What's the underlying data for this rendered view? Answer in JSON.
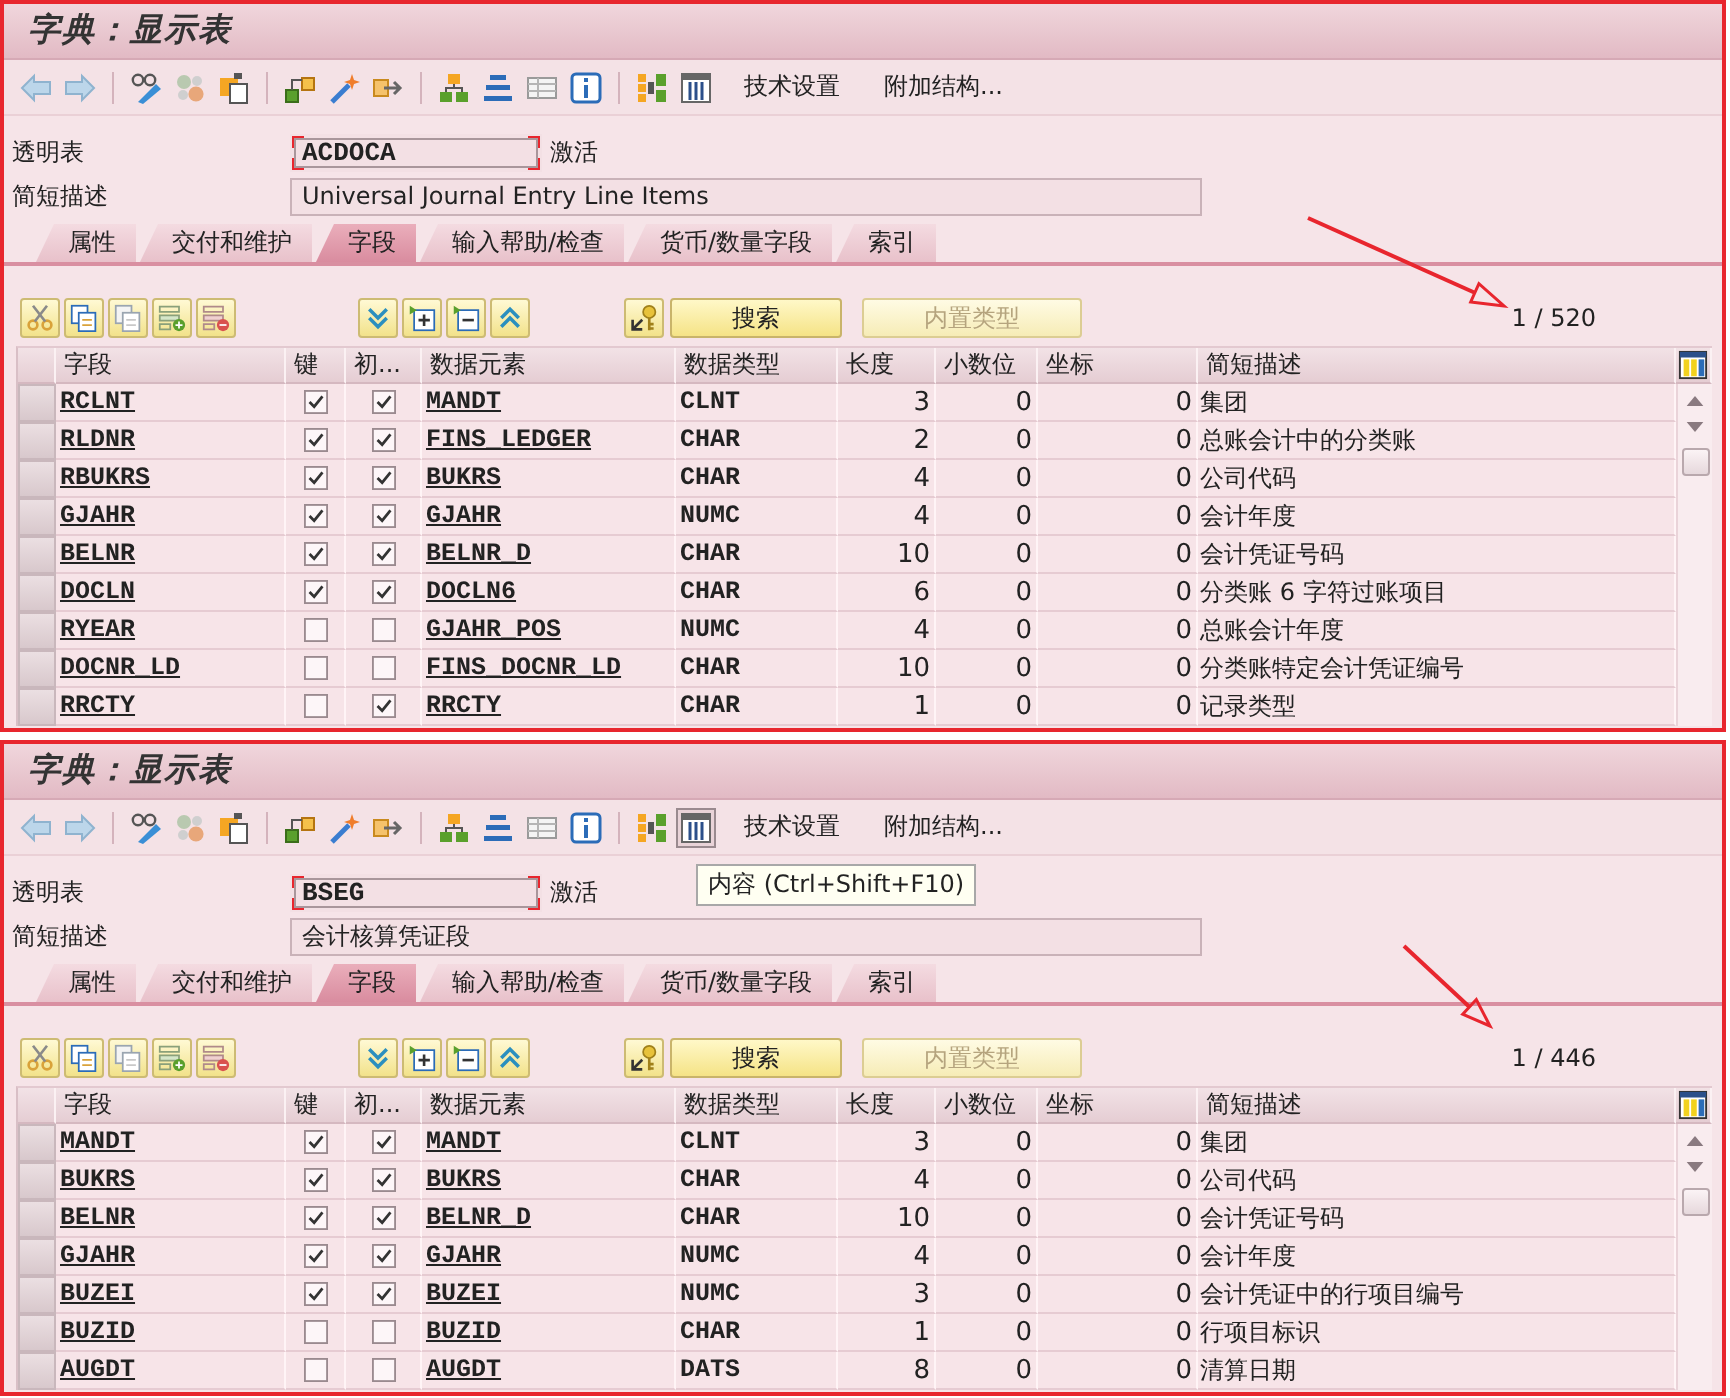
{
  "screens": [
    {
      "title": "字典：显示表",
      "toolbar_buttons": [
        "技术设置",
        "附加结构..."
      ],
      "fields": [
        {
          "label": "透明表",
          "value": "ACDOCA",
          "status": "激活",
          "focused": true
        },
        {
          "label": "简短描述",
          "value": "Universal Journal Entry Line Items",
          "focused": false
        }
      ],
      "tabs": [
        {
          "label": "属性",
          "selected": false
        },
        {
          "label": "交付和维护",
          "selected": false
        },
        {
          "label": "字段",
          "selected": true
        },
        {
          "label": "输入帮助/检查",
          "selected": false
        },
        {
          "label": "货币/数量字段",
          "selected": false
        },
        {
          "label": "索引",
          "selected": false
        }
      ],
      "table_toolbar": [
        {
          "label": "搜索",
          "disabled": false
        },
        {
          "label": "内置类型",
          "disabled": true
        }
      ],
      "count": "1 / 520",
      "table": {
        "columns": [
          "字段",
          "键",
          "初...",
          "数据元素",
          "数据类型",
          "长度",
          "小数位",
          "坐标",
          "简短描述"
        ],
        "rows": [
          {
            "field": "RCLNT",
            "key": true,
            "initial": true,
            "data_element": "MANDT",
            "data_type": "CLNT",
            "length": "3",
            "decimals": "0",
            "coordinate": "0",
            "description": "集团"
          },
          {
            "field": "RLDNR",
            "key": true,
            "initial": true,
            "data_element": "FINS_LEDGER",
            "data_type": "CHAR",
            "length": "2",
            "decimals": "0",
            "coordinate": "0",
            "description": "总账会计中的分类账"
          },
          {
            "field": "RBUKRS",
            "key": true,
            "initial": true,
            "data_element": "BUKRS",
            "data_type": "CHAR",
            "length": "4",
            "decimals": "0",
            "coordinate": "0",
            "description": "公司代码"
          },
          {
            "field": "GJAHR",
            "key": true,
            "initial": true,
            "data_element": "GJAHR",
            "data_type": "NUMC",
            "length": "4",
            "decimals": "0",
            "coordinate": "0",
            "description": "会计年度"
          },
          {
            "field": "BELNR",
            "key": true,
            "initial": true,
            "data_element": "BELNR_D",
            "data_type": "CHAR",
            "length": "10",
            "decimals": "0",
            "coordinate": "0",
            "description": "会计凭证号码"
          },
          {
            "field": "DOCLN",
            "key": true,
            "initial": true,
            "data_element": "DOCLN6",
            "data_type": "CHAR",
            "length": "6",
            "decimals": "0",
            "coordinate": "0",
            "description": "分类账 6 字符过账项目"
          },
          {
            "field": "RYEAR",
            "key": false,
            "initial": false,
            "data_element": "GJAHR_POS",
            "data_type": "NUMC",
            "length": "4",
            "decimals": "0",
            "coordinate": "0",
            "description": "总账会计年度"
          },
          {
            "field": "DOCNR_LD",
            "key": false,
            "initial": false,
            "data_element": "FINS_DOCNR_LD",
            "data_type": "CHAR",
            "length": "10",
            "decimals": "0",
            "coordinate": "0",
            "description": "分类账特定会计凭证编号"
          },
          {
            "field": "RRCTY",
            "key": false,
            "initial": true,
            "data_element": "RRCTY",
            "data_type": "CHAR",
            "length": "1",
            "decimals": "0",
            "coordinate": "0",
            "description": "记录类型"
          }
        ]
      }
    },
    {
      "title": "字典：显示表",
      "toolbar_buttons": [
        "技术设置",
        "附加结构..."
      ],
      "tooltip": "内容 (Ctrl+Shift+F10)",
      "fields": [
        {
          "label": "透明表",
          "value": "BSEG",
          "status": "激活",
          "focused": true
        },
        {
          "label": "简短描述",
          "value": "会计核算凭证段",
          "focused": false
        }
      ],
      "tabs": [
        {
          "label": "属性",
          "selected": false
        },
        {
          "label": "交付和维护",
          "selected": false
        },
        {
          "label": "字段",
          "selected": true
        },
        {
          "label": "输入帮助/检查",
          "selected": false
        },
        {
          "label": "货币/数量字段",
          "selected": false
        },
        {
          "label": "索引",
          "selected": false
        }
      ],
      "table_toolbar": [
        {
          "label": "搜索",
          "disabled": false
        },
        {
          "label": "内置类型",
          "disabled": true
        }
      ],
      "count": "1 / 446",
      "table": {
        "columns": [
          "字段",
          "键",
          "初...",
          "数据元素",
          "数据类型",
          "长度",
          "小数位",
          "坐标",
          "简短描述"
        ],
        "rows": [
          {
            "field": "MANDT",
            "key": true,
            "initial": true,
            "data_element": "MANDT",
            "data_type": "CLNT",
            "length": "3",
            "decimals": "0",
            "coordinate": "0",
            "description": "集团"
          },
          {
            "field": "BUKRS",
            "key": true,
            "initial": true,
            "data_element": "BUKRS",
            "data_type": "CHAR",
            "length": "4",
            "decimals": "0",
            "coordinate": "0",
            "description": "公司代码"
          },
          {
            "field": "BELNR",
            "key": true,
            "initial": true,
            "data_element": "BELNR_D",
            "data_type": "CHAR",
            "length": "10",
            "decimals": "0",
            "coordinate": "0",
            "description": "会计凭证号码"
          },
          {
            "field": "GJAHR",
            "key": true,
            "initial": true,
            "data_element": "GJAHR",
            "data_type": "NUMC",
            "length": "4",
            "decimals": "0",
            "coordinate": "0",
            "description": "会计年度"
          },
          {
            "field": "BUZEI",
            "key": true,
            "initial": true,
            "data_element": "BUZEI",
            "data_type": "NUMC",
            "length": "3",
            "decimals": "0",
            "coordinate": "0",
            "description": "会计凭证中的行项目编号"
          },
          {
            "field": "BUZID",
            "key": false,
            "initial": false,
            "data_element": "BUZID",
            "data_type": "CHAR",
            "length": "1",
            "decimals": "0",
            "coordinate": "0",
            "description": "行项目标识"
          },
          {
            "field": "AUGDT",
            "key": false,
            "initial": false,
            "data_element": "AUGDT",
            "data_type": "DATS",
            "length": "8",
            "decimals": "0",
            "coordinate": "0",
            "description": "清算日期"
          }
        ]
      }
    }
  ]
}
